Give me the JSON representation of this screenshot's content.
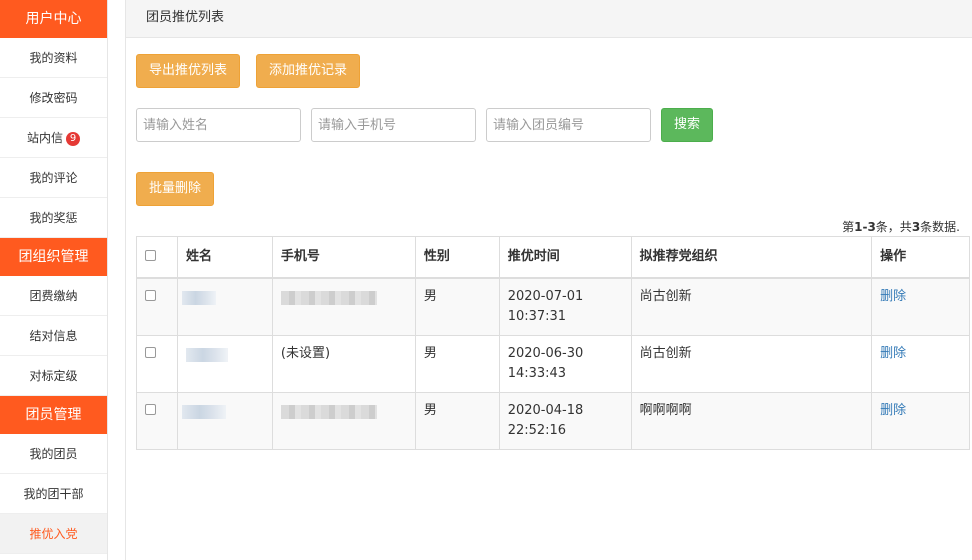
{
  "sidebar": {
    "sections": [
      {
        "title": "用户中心",
        "items": [
          {
            "label": "我的资料"
          },
          {
            "label": "修改密码"
          },
          {
            "label": "站内信",
            "badge": "9"
          },
          {
            "label": "我的评论"
          },
          {
            "label": "我的奖惩"
          }
        ]
      },
      {
        "title": "团组织管理",
        "items": [
          {
            "label": "团费缴纳"
          },
          {
            "label": "结对信息"
          },
          {
            "label": "对标定级"
          }
        ]
      },
      {
        "title": "团员管理",
        "items": [
          {
            "label": "我的团员"
          },
          {
            "label": "我的团干部"
          },
          {
            "label": "推优入党",
            "active": true
          }
        ]
      }
    ]
  },
  "panel": {
    "title": "团员推优列表"
  },
  "toolbar": {
    "export_label": "导出推优列表",
    "add_label": "添加推优记录",
    "batch_delete_label": "批量删除"
  },
  "search": {
    "name_placeholder": "请输入姓名",
    "phone_placeholder": "请输入手机号",
    "member_no_placeholder": "请输入团员编号",
    "search_label": "搜索"
  },
  "summary": {
    "prefix": "第",
    "range": "1-3",
    "middle": "条，共",
    "total": "3",
    "suffix": "条数据."
  },
  "table": {
    "columns": [
      "姓名",
      "手机号",
      "性别",
      "推优时间",
      "拟推荐党组织",
      "操作"
    ],
    "rows": [
      {
        "name": "",
        "phone": "",
        "gender": "男",
        "date": "2020-07-01",
        "time": "10:37:31",
        "org": "尚古创新",
        "action": "删除"
      },
      {
        "name": "",
        "phone": "(未设置)",
        "gender": "男",
        "date": "2020-06-30",
        "time": "14:33:43",
        "org": "尚古创新",
        "action": "删除"
      },
      {
        "name": "",
        "phone": "",
        "gender": "男",
        "date": "2020-04-18",
        "time": "22:52:16",
        "org": "啊啊啊啊",
        "action": "删除"
      }
    ]
  },
  "colors": {
    "accent": "#ff5a1f",
    "warning": "#f0ad4e",
    "success": "#5cb85c",
    "link": "#337ab7"
  }
}
